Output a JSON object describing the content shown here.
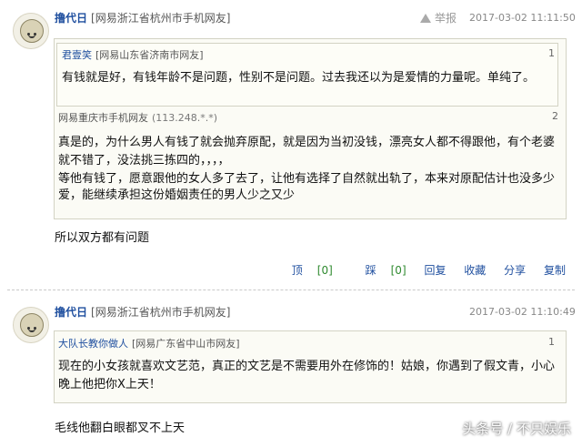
{
  "comments": [
    {
      "user": "撸代日",
      "location": "[网易浙江省杭州市手机网友]",
      "report_label": "举报",
      "timestamp": "2017-03-02 11:11:50",
      "quotes": [
        {
          "name": "君壹笑",
          "location": "[网易山东省济南市网友]",
          "number": "1",
          "text": "有钱就是好，有钱年龄不是问题，性别不是问题。过去我还以为是爱情的力量呢。单纯了。"
        },
        {
          "name": "",
          "location": "网易重庆市手机网友",
          "ip": "(113.248.*.*)",
          "number": "2",
          "lines": [
            "真是的，为什么男人有钱了就会抛弃原配，就是因为当初没钱，漂亮女人都不得跟他，有个老婆",
            "就不错了，没法挑三拣四的，，，，",
            "等他有钱了，愿意跟他的女人多了去了，让他有选择了自然就出轨了，本来对原配估计也没多少",
            "爱，能继续承担这份婚姻责任的男人少之又少"
          ]
        }
      ],
      "body": "所以双方都有问题",
      "actions": {
        "ding": "顶",
        "ding_count": "[0]",
        "cai": "踩",
        "cai_count": "[0]",
        "reply": "回复",
        "collect": "收藏",
        "share": "分享",
        "copy": "复制"
      }
    },
    {
      "user": "撸代日",
      "location": "[网易浙江省杭州市手机网友]",
      "timestamp": "2017-03-02 11:10:49",
      "quotes": [
        {
          "name": "大队长教你做人",
          "location": "[网易广东省中山市网友]",
          "number": "1",
          "lines": [
            "现在的小女孩就喜欢文艺范，真正的文艺是不需要用外在修饰的！姑娘，你遇到了假文青，小心",
            "晚上他把你X上天！"
          ]
        }
      ],
      "body": "毛线他翻白眼都叉不上天"
    }
  ],
  "watermark": "头条号 / 不只娱乐"
}
